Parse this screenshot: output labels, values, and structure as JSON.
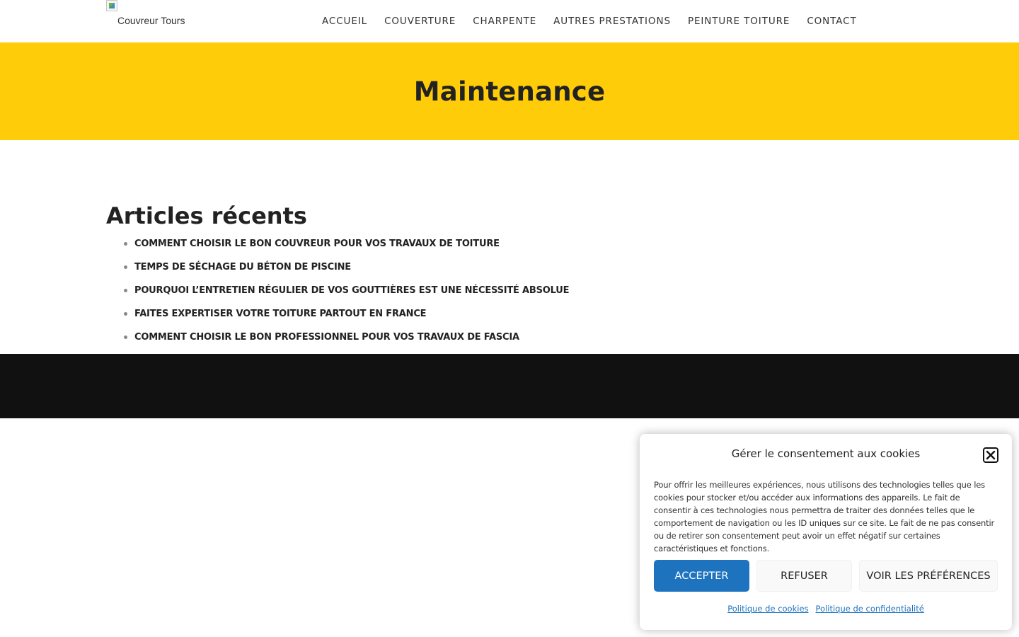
{
  "header": {
    "logo_alt": "Couvreur Tours",
    "nav": [
      {
        "label": "ACCUEIL"
      },
      {
        "label": "COUVERTURE"
      },
      {
        "label": "CHARPENTE"
      },
      {
        "label": "AUTRES PRESTATIONS"
      },
      {
        "label": "PEINTURE TOITURE"
      },
      {
        "label": "CONTACT"
      }
    ]
  },
  "hero": {
    "title": "Maintenance",
    "background_color": "#fecc08"
  },
  "recent_posts": {
    "title": "Articles récents",
    "items": [
      {
        "label": "COMMENT CHOISIR LE BON COUVREUR POUR VOS TRAVAUX DE TOITURE"
      },
      {
        "label": "TEMPS DE SÉCHAGE DU BÉTON DE PISCINE"
      },
      {
        "label": "POURQUOI L’ENTRETIEN RÉGULIER DE VOS GOUTTIÈRES EST UNE NÉCESSITÉ ABSOLUE"
      },
      {
        "label": "FAITES EXPERTISER VOTRE TOITURE PARTOUT EN FRANCE"
      },
      {
        "label": "COMMENT CHOISIR LE BON PROFESSIONNEL POUR VOS TRAVAUX DE FASCIA"
      }
    ]
  },
  "footer": {
    "background_color": "#111111"
  },
  "cookie_banner": {
    "title": "Gérer le consentement aux cookies",
    "text": "Pour offrir les meilleures expériences, nous utilisons des technologies telles que les cookies pour stocker et/ou accéder aux informations des appareils. Le fait de consentir à ces technologies nous permettra de traiter des données telles que le comportement de navigation ou les ID uniques sur ce site. Le fait de ne pas consentir ou de retirer son consentement peut avoir un effet négatif sur certaines caractéristiques et fonctions.",
    "accept_label": "ACCEPTER",
    "deny_label": "REFUSER",
    "prefs_label": "VOIR LES PRÉFÉRENCES",
    "cookie_policy_label": "Politique de cookies",
    "privacy_policy_label": "Politique de confidentialité",
    "accent_color": "#1e73be",
    "close_icon": "close-icon"
  }
}
